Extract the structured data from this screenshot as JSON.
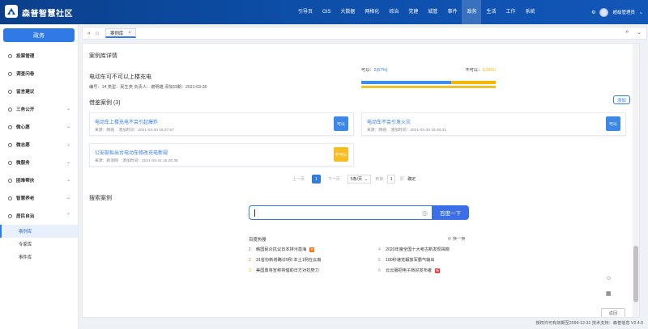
{
  "app": {
    "brand": "森普智慧社区"
  },
  "nav": {
    "items": [
      "引导页",
      "GIS",
      "大数据",
      "网格化",
      "综治",
      "党建",
      "城管",
      "事件",
      "政务",
      "生活",
      "工作",
      "系统"
    ],
    "active": "政务"
  },
  "user": {
    "name": "超级管理员"
  },
  "sidebar": {
    "title": "政务",
    "items": [
      {
        "label": "投票管理",
        "chevron": ""
      },
      {
        "label": "调查问卷",
        "chevron": ""
      },
      {
        "label": "留言建议",
        "chevron": ""
      },
      {
        "label": "三务公开",
        "chevron": "⌄"
      },
      {
        "label": "微心愿",
        "chevron": "⌄"
      },
      {
        "label": "微志愿",
        "chevron": "⌄"
      },
      {
        "label": "微服务",
        "chevron": "⌄"
      },
      {
        "label": "困难帮扶",
        "chevron": "⌄"
      },
      {
        "label": "智慧养老",
        "chevron": "⌄"
      },
      {
        "label": "居民自治",
        "chevron": "⌃"
      }
    ],
    "subitems": [
      "案例库",
      "专家库",
      "事件库"
    ],
    "active_sub": "案例库"
  },
  "tabs": {
    "current": "案例库"
  },
  "case": {
    "section_title": "案例库详情",
    "subject": "电动车可不可以上楼充电",
    "meta": "编号：14    类型：民生类    负责人：谢明雄    添加日期：2021-03-30",
    "vote": {
      "yes_label": "可以：",
      "yes_pct": "2(67%)",
      "no_label": "不可以：",
      "no_pct": "1(33%)",
      "yes_fraction": 0.67
    },
    "refs_title": "借鉴案例 (3)",
    "add_label": "添加"
  },
  "cards": [
    {
      "title": "电动车上楼充电不会引起爆炸",
      "source": "来源：网络",
      "time": "添加时间：2021-03-30 16:27:57",
      "button": "可以",
      "variant": "blue"
    },
    {
      "title": "电动车不会引发火灾",
      "source": "来源：网络",
      "time": "添加时间：2021-03-30 16:26:31",
      "button": "可以",
      "variant": "blue"
    },
    {
      "title": "公安部拟出台电动车修改充电新规",
      "source": "来源：新浪网",
      "time": "添加时间：2021-03-31 15:20:38",
      "button": "不可以",
      "variant": "yellow"
    }
  ],
  "pager": {
    "prev": "上一页",
    "current": "1",
    "next": "下一页",
    "size": "5条/页",
    "goto": "到第",
    "page_input": "1",
    "page_unit": "页",
    "confirm": "确定"
  },
  "search": {
    "title": "搜索案例",
    "button": "百度一下"
  },
  "hot": {
    "title": "百度热搜",
    "refresh": "换一换",
    "items": [
      {
        "num": "1",
        "text": "韩国民众抗议日本排污患海",
        "badge": "热"
      },
      {
        "num": "2",
        "text": "31省份新增确诊9例 本土1例在云南",
        "badge": ""
      },
      {
        "num": "3",
        "text": "美国勇将宣称将借助日方对抗势力",
        "badge": ""
      },
      {
        "num": "4",
        "text": "2020年度全国十大考古新发现揭晓",
        "badge": ""
      },
      {
        "num": "5",
        "text": "100秒速览解放军霸气输出",
        "badge": ""
      },
      {
        "num": "6",
        "text": "云云服把电子商好发布者",
        "badge": "新"
      }
    ]
  },
  "float": {
    "top": "返回"
  },
  "footer": {
    "text": "授权许可有效期至2099-12-31 技术支持：森普信息  V2.4.0"
  },
  "icons": {
    "collapse": "«",
    "home": "⌂",
    "tab_close": "×",
    "expand": "»",
    "more": "⌄",
    "gear": "⚙",
    "camera": "◎",
    "chat": "☺",
    "qrcode": "▦",
    "refresh": "⟳",
    "caret": "⌄"
  },
  "colors": {
    "primary": "#2f7ae5",
    "topbar": "#0d4ea8",
    "yes": "#3c8ef0",
    "no": "#f7b500"
  }
}
